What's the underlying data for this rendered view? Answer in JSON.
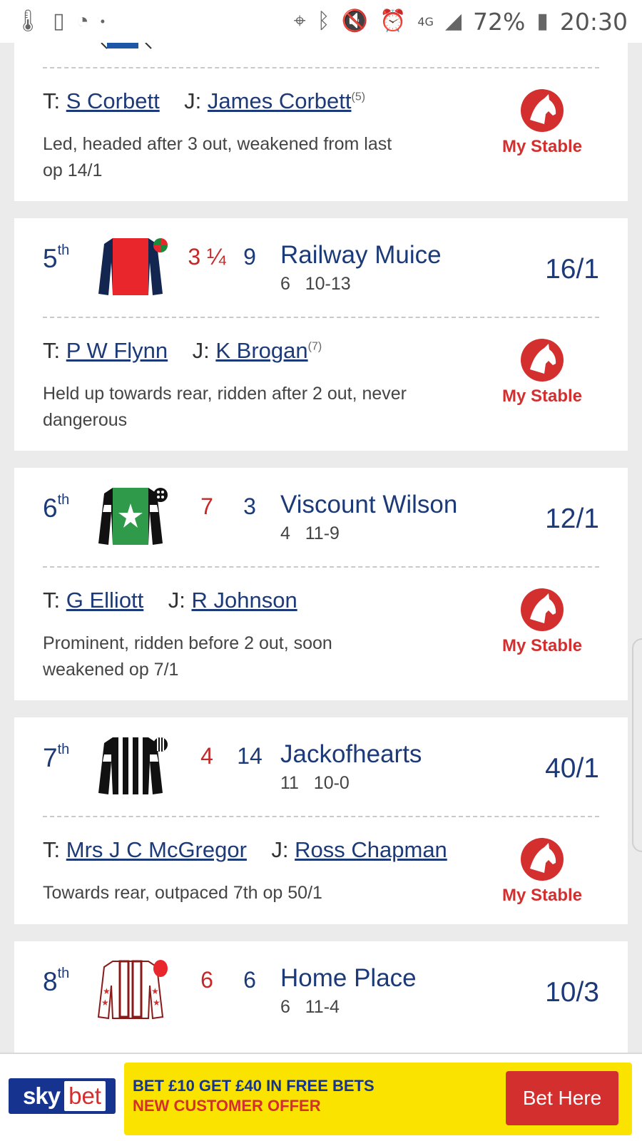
{
  "status_bar": {
    "battery": "72%",
    "time": "20:30",
    "network": "4G"
  },
  "my_stable_label": "My Stable",
  "cards": [
    {
      "trainer_label": "T:",
      "trainer": "S Corbett",
      "jockey_label": "J:",
      "jockey": "James Corbett",
      "allowance": "(5)",
      "comment": "Led, headed after 3 out, weakened from last op 14/1"
    },
    {
      "position": "5",
      "ordinal": "th",
      "distance": "3 ¼",
      "draw": "9",
      "horse": "Railway Muice",
      "age": "6",
      "weight": "10-13",
      "odds": "16/1",
      "trainer_label": "T:",
      "trainer": "P W Flynn",
      "jockey_label": "J:",
      "jockey": "K Brogan",
      "allowance": "(7)",
      "comment": "Held up towards rear, ridden after 2 out, never dangerous"
    },
    {
      "position": "6",
      "ordinal": "th",
      "distance": "7",
      "draw": "3",
      "horse": "Viscount Wilson",
      "age": "4",
      "weight": "11-9",
      "odds": "12/1",
      "trainer_label": "T:",
      "trainer": "G Elliott",
      "jockey_label": "J:",
      "jockey": "R Johnson",
      "comment": "Prominent, ridden before 2 out, soon weakened op 7/1"
    },
    {
      "position": "7",
      "ordinal": "th",
      "distance": "4",
      "draw": "14",
      "horse": "Jackofhearts",
      "age": "11",
      "weight": "10-0",
      "odds": "40/1",
      "trainer_label": "T:",
      "trainer": "Mrs J C McGregor",
      "jockey_label": "J:",
      "jockey": "Ross Chapman",
      "comment": "Towards rear, outpaced 7th op 50/1"
    },
    {
      "position": "8",
      "ordinal": "th",
      "distance": "6",
      "draw": "6",
      "horse": "Home Place",
      "age": "6",
      "weight": "11-4",
      "odds": "10/3"
    }
  ],
  "banner": {
    "brand_sky": "sky",
    "brand_bet": "bet",
    "line1": "BET £10 GET £40 IN FREE BETS",
    "line2": "NEW CUSTOMER OFFER",
    "button": "Bet Here"
  },
  "colors": {
    "navy": "#1c3a78",
    "red": "#d32f2f",
    "banner_yellow": "#fbe300",
    "skybet_blue": "#16348f"
  }
}
